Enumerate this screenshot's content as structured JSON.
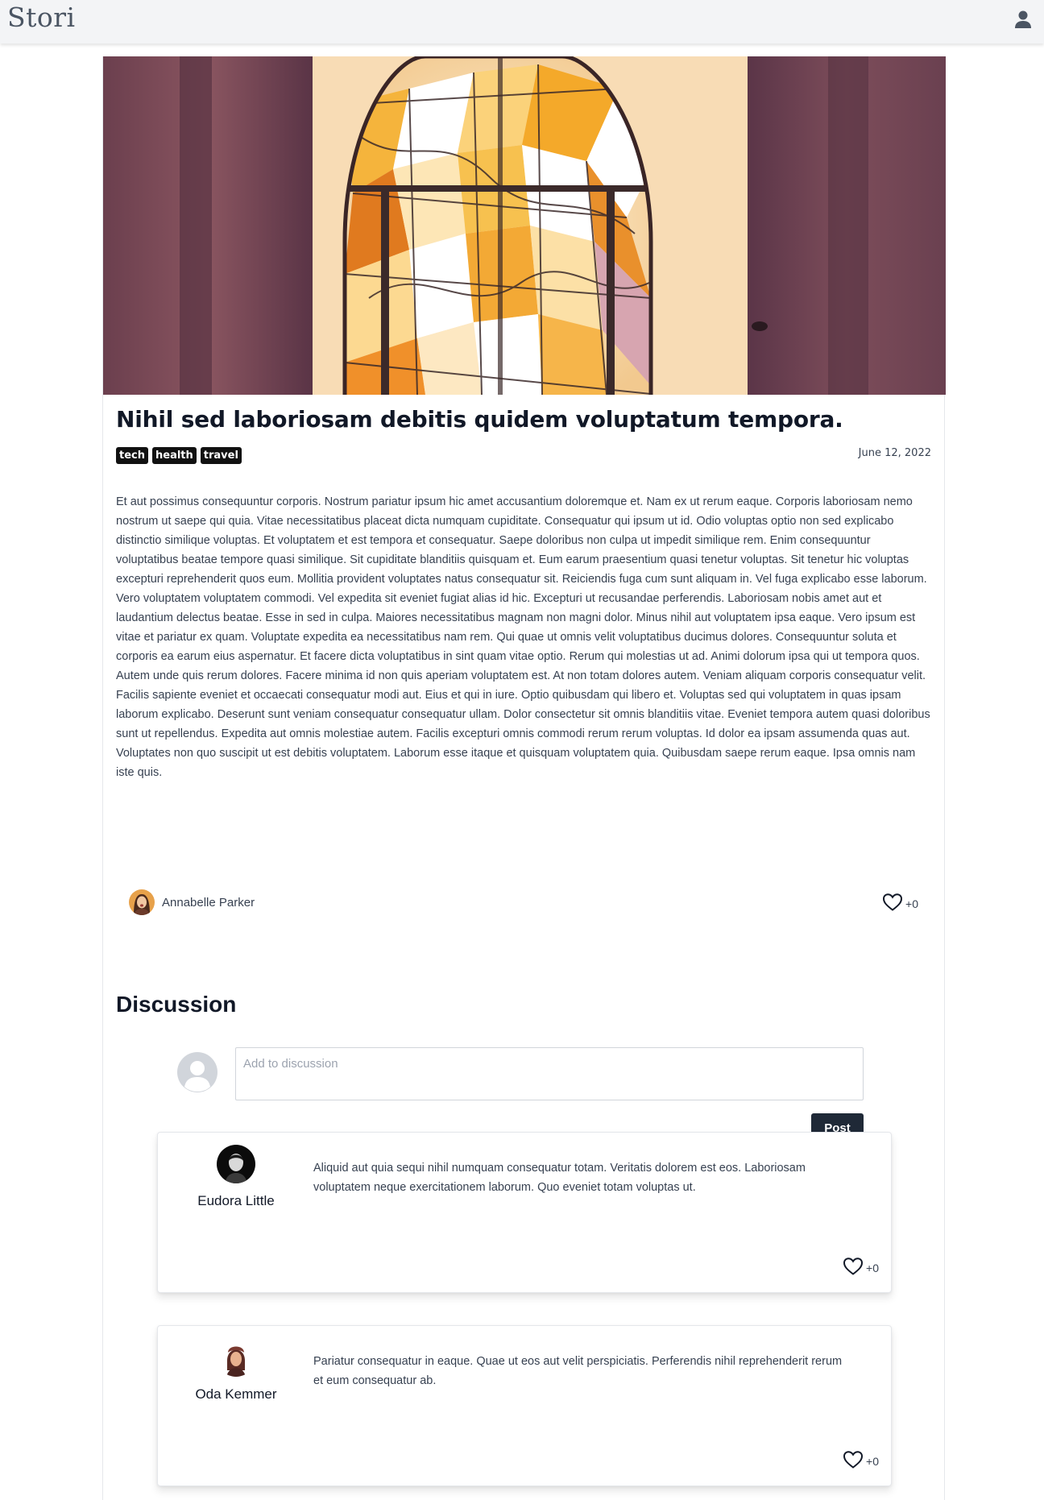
{
  "app": {
    "brand": "Stori"
  },
  "header": {
    "user_icon": "user-icon"
  },
  "post": {
    "hero_image": "stained-glass-window-photo",
    "title": "Nihil sed laboriosam debitis quidem voluptatum tempora.",
    "tags": [
      "tech",
      "health",
      "travel"
    ],
    "date": "June 12, 2022",
    "body": "Et aut possimus consequuntur corporis. Nostrum pariatur ipsum hic amet accusantium doloremque et. Nam ex ut rerum eaque. Corporis laboriosam nemo nostrum ut saepe qui quia. Vitae necessitatibus placeat dicta numquam cupiditate. Consequatur qui ipsum ut id. Odio voluptas optio non sed explicabo distinctio similique voluptas. Et voluptatem et est tempora et consequatur. Saepe doloribus non culpa ut impedit similique rem. Enim consequuntur voluptatibus beatae tempore quasi similique. Sit cupiditate blanditiis quisquam et. Eum earum praesentium quasi tenetur voluptas. Sit tenetur hic voluptas excepturi reprehenderit quos eum. Mollitia provident voluptates natus consequatur sit. Reiciendis fuga cum sunt aliquam in. Vel fuga explicabo esse laborum. Vero voluptatem voluptatem commodi. Vel expedita sit eveniet fugiat alias id hic. Excepturi ut recusandae perferendis. Laboriosam nobis amet aut et laudantium delectus beatae. Esse in sed in culpa. Maiores necessitatibus magnam non magni dolor. Minus nihil aut voluptatem ipsa eaque. Vero ipsum est vitae et pariatur ex quam. Voluptate expedita ea necessitatibus nam rem. Qui quae ut omnis velit voluptatibus ducimus dolores. Consequuntur soluta et corporis ea earum eius aspernatur. Et facere dicta voluptatibus in sint quam vitae optio. Rerum qui molestias ut ad. Animi dolorum ipsa qui ut tempora quos. Autem unde quis rerum dolores. Facere minima id non quis aperiam voluptatem est. At non totam dolores autem. Veniam aliquam corporis consequatur velit. Facilis sapiente eveniet et occaecati consequatur modi aut. Eius et qui in iure. Optio quibusdam qui libero et. Voluptas sed qui voluptatem in quas ipsam laborum explicabo. Deserunt sunt veniam consequatur consequatur ullam. Dolor consectetur sit omnis blanditiis vitae. Eveniet tempora autem quasi doloribus sunt ut repellendus. Expedita aut omnis molestiae autem. Facilis excepturi omnis commodi rerum rerum voluptas. Id dolor ea ipsam assumenda quas aut. Voluptates non quo suscipit ut est debitis voluptatem. Laborum esse itaque et quisquam voluptatem quia. Quibusdam saepe rerum eaque. Ipsa omnis nam iste quis.",
    "author": "Annabelle Parker",
    "likes": "+0"
  },
  "discussion": {
    "title": "Discussion",
    "placeholder": "Add to discussion",
    "post_label": "Post",
    "comments": [
      {
        "author": "Eudora Little",
        "text": "Aliquid aut quia sequi nihil numquam consequatur totam. Veritatis dolorem est eos. Laboriosam voluptatem neque exercitationem laborum. Quo eveniet totam voluptas ut.",
        "likes": "+0"
      },
      {
        "author": "Oda Kemmer",
        "text": "Pariatur consequatur in eaque. Quae ut eos aut velit perspiciatis. Perferendis nihil reprehenderit rerum et eum consequatur ab.",
        "likes": "+0"
      }
    ]
  },
  "colors": {
    "topbar": "#f3f4f6",
    "tag_bg": "#111111",
    "button_bg": "#1f2937",
    "text": "#374151"
  },
  "icons": {
    "like": "heart-icon",
    "user": "user-icon",
    "default_avatar": "default-avatar-icon"
  }
}
